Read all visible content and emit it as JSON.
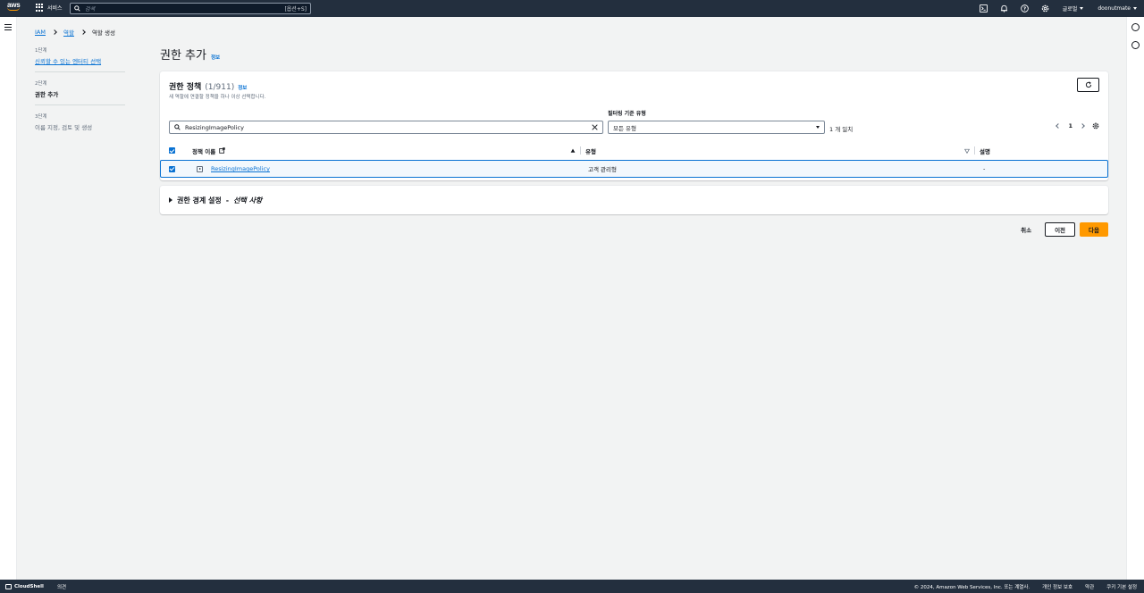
{
  "topnav": {
    "logo": "aws",
    "services_label": "서비스",
    "search_placeholder": "검색",
    "search_shortcut": "[옵션+S]",
    "region_label": "글로벌",
    "account_label": "doonutmate",
    "icons": [
      "cloudshell-icon",
      "bell-icon",
      "help-icon",
      "gear-icon"
    ]
  },
  "breadcrumb": [
    "IAM",
    "역할",
    "역할 생성"
  ],
  "steps": [
    {
      "num": "1단계",
      "label": "신뢰할 수 있는 엔터티 선택",
      "state": "link"
    },
    {
      "num": "2단계",
      "label": "권한 추가",
      "state": "current"
    },
    {
      "num": "3단계",
      "label": "이름 지정, 검토 및 생성",
      "state": "disabled"
    }
  ],
  "page": {
    "title": "권한 추가",
    "info": "정보"
  },
  "policies": {
    "heading": "권한 정책",
    "count": "(1/911)",
    "info": "정보",
    "subtitle": "새 역할에 연결할 정책을 하나 이상 선택합니다.",
    "filter_label": "필터링 기준 유형",
    "search_value": "ResizingImagePolicy",
    "filter_value": "모든 유형",
    "match_count": "1 개 일치",
    "page_number": "1",
    "columns": {
      "name": "정책 이름",
      "type": "유형",
      "desc": "설명"
    },
    "rows": [
      {
        "name": "ResizingImagePolicy",
        "type": "고객 관리형",
        "desc": "-",
        "selected": true
      }
    ]
  },
  "boundary": {
    "title": "권한 경계 설정",
    "optional": "선택 사항"
  },
  "actions": {
    "cancel": "취소",
    "previous": "이전",
    "next": "다음"
  },
  "footer": {
    "cloudshell": "CloudShell",
    "feedback": "의견",
    "copyright": "© 2024, Amazon Web Services, Inc. 또는 계열사.",
    "privacy": "개인 정보 보호",
    "terms": "약관",
    "cookies": "쿠키 기본 설정"
  },
  "colors": {
    "nav": "#232f3e",
    "link": "#0972d3",
    "primary": "#ff9900"
  }
}
